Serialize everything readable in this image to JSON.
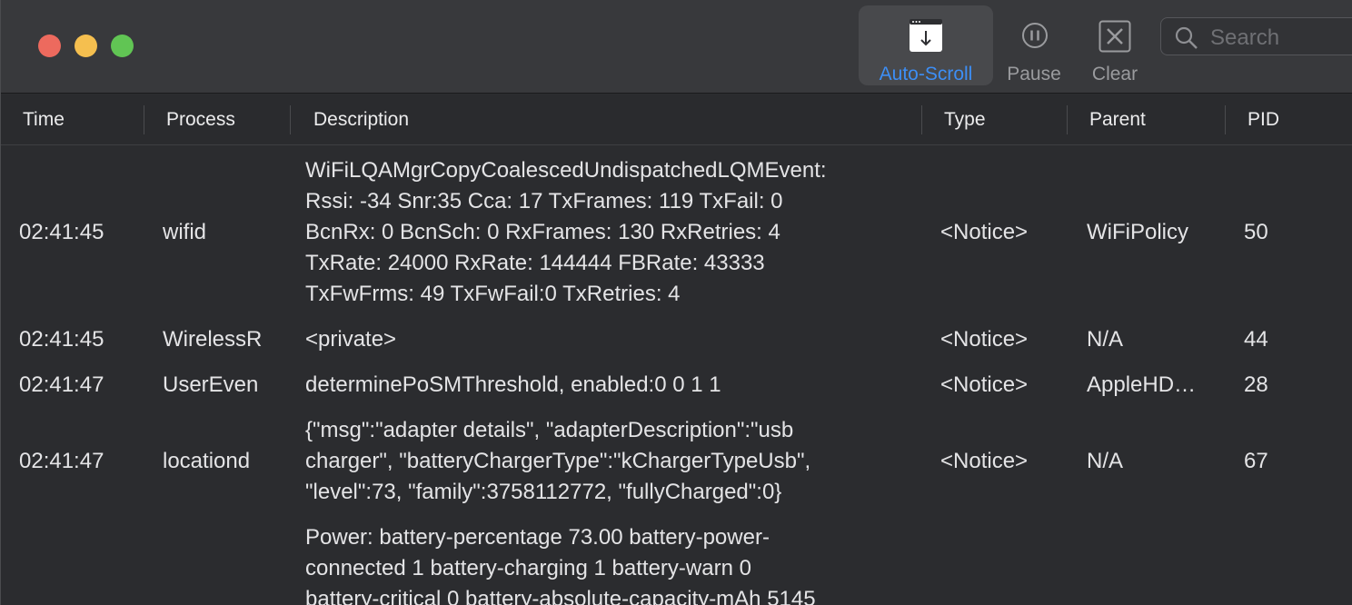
{
  "toolbar": {
    "autoscroll_label": "Auto-Scroll",
    "pause_label": "Pause",
    "clear_label": "Clear",
    "search_placeholder": "Search",
    "accent_color": "#3d8ef5"
  },
  "columns": {
    "time": "Time",
    "process": "Process",
    "description": "Description",
    "type": "Type",
    "parent": "Parent",
    "pid": "PID"
  },
  "rows": [
    {
      "time": "02:41:45",
      "process": "wifid",
      "desc": [
        "WiFiLQAMgrCopyCoalescedUndispatchedLQMEvent:",
        "Rssi: -34 Snr:35 Cca: 17 TxFrames: 119 TxFail: 0",
        "BcnRx: 0 BcnSch: 0  RxFrames: 130 RxRetries: 4",
        "TxRate: 24000 RxRate: 144444 FBRate: 43333",
        "TxFwFrms: 49 TxFwFail:0 TxRetries: 4"
      ],
      "type": "<Notice>",
      "parent": "WiFiPolicy",
      "pid": "50"
    },
    {
      "time": "02:41:45",
      "process": "WirelessR",
      "desc": [
        "<private>"
      ],
      "type": "<Notice>",
      "parent": "N/A",
      "pid": "44"
    },
    {
      "time": "02:41:47",
      "process": "UserEven",
      "desc": [
        "determinePoSMThreshold, enabled:0 0 1 1"
      ],
      "type": "<Notice>",
      "parent": "AppleHD…",
      "pid": "28"
    },
    {
      "time": "02:41:47",
      "process": "locationd",
      "desc": [
        "{\"msg\":\"adapter details\", \"adapterDescription\":\"usb",
        "charger\", \"batteryChargerType\":\"kChargerTypeUsb\",",
        "\"level\":73, \"family\":3758112772, \"fullyCharged\":0}"
      ],
      "type": "<Notice>",
      "parent": "N/A",
      "pid": "67"
    },
    {
      "time": "",
      "process": "",
      "desc": [
        "Power: battery-percentage 73.00 battery-power-",
        "connected 1 battery-charging 1 battery-warn 0",
        "battery-critical 0 battery-absolute-capacity-mAh 5145"
      ],
      "type": "",
      "parent": "",
      "pid": ""
    }
  ]
}
